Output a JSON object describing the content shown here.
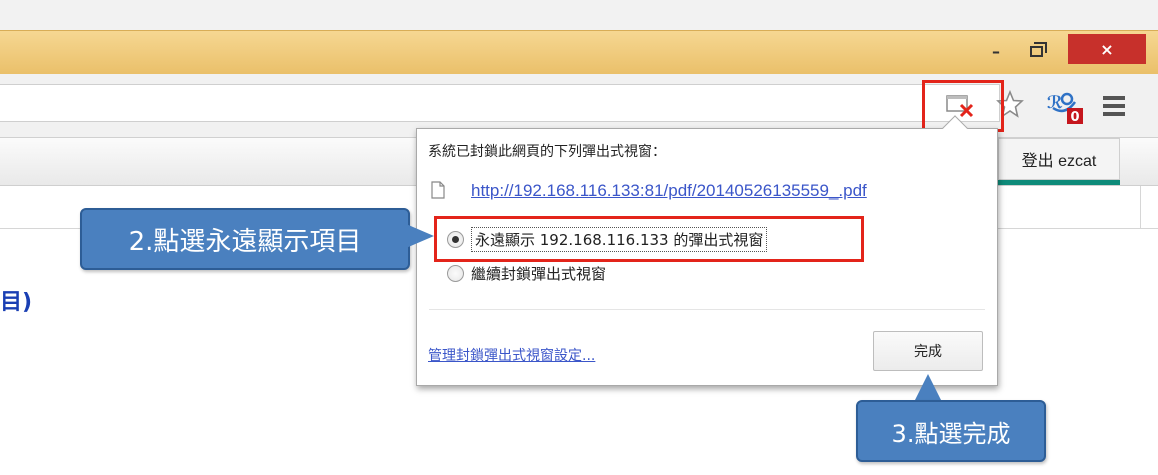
{
  "window": {
    "minimize_label": "–",
    "close_label": "×"
  },
  "toolbar": {
    "icons": [
      "popup-blocked-icon",
      "star-icon",
      "extension-icon",
      "menu-icon"
    ],
    "extension_badge": "0"
  },
  "page": {
    "logout_label": "登出 ezcat",
    "partial_link_text": "目)"
  },
  "popup_bubble": {
    "title": "系統已封鎖此網頁的下列彈出式視窗：",
    "blocked_url": "http://192.168.116.133:81/pdf/20140526135559_.pdf",
    "option_always_show": "永遠顯示 192.168.116.133 的彈出式視窗",
    "option_keep_blocking": "繼續封鎖彈出式視窗",
    "selected_option": "option_always_show",
    "manage_link": "管理封鎖彈出式視窗設定...",
    "done_label": "完成"
  },
  "callouts": {
    "step2": "2.點選永遠顯示項目",
    "step3": "3.點選完成"
  },
  "colors": {
    "highlight_red": "#e3241a",
    "callout_blue": "#4a80bf",
    "titlebar_gold": "#f0cc7e",
    "close_red": "#c7302b",
    "link_blue": "#3b56c9"
  }
}
